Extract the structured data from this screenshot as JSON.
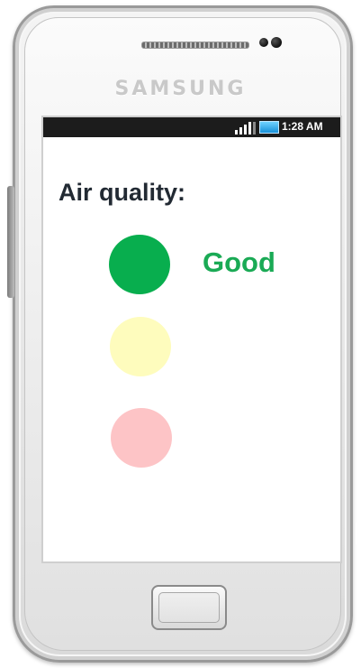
{
  "device": {
    "brand": "SAMSUNG"
  },
  "status_bar": {
    "time": "1:28 AM",
    "icons": [
      "signal-strength-icon",
      "battery-icon"
    ]
  },
  "app": {
    "title": "Air quality:",
    "current_status": "Good",
    "status_color": "#1aaa55",
    "indicators": [
      {
        "level": "good",
        "color": "#08ae4e",
        "active": true
      },
      {
        "level": "moderate",
        "color": "#fefcbd",
        "active": false
      },
      {
        "level": "bad",
        "color": "#fdc4c6",
        "active": false
      }
    ]
  }
}
